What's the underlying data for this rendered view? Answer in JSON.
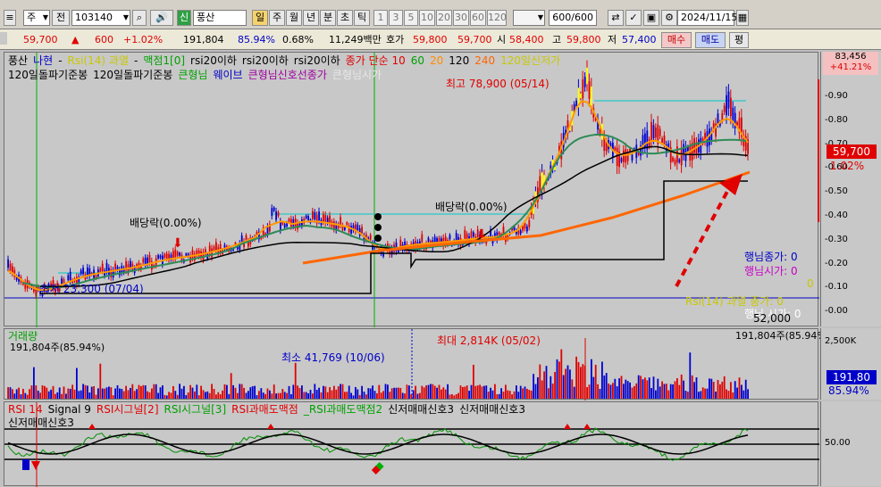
{
  "toolbar": {
    "market": "주",
    "period_label": "전",
    "code": "103140",
    "badge": "신",
    "stock_name": "풍산",
    "periods": [
      "일",
      "주",
      "월",
      "년",
      "분",
      "초",
      "틱"
    ],
    "active_period": "일",
    "minutes": [
      "1",
      "3",
      "5",
      "10",
      "20",
      "30",
      "60",
      "120"
    ],
    "count": "600/600",
    "date": "2024/11/15"
  },
  "quote": {
    "price": "59,700",
    "change": "600",
    "change_pct": "+1.02%",
    "volume": "191,804",
    "volume_ratio": "85.94%",
    "turnover_rate": "0.68%",
    "amount": "11,249백만",
    "bid_label": "호가",
    "bid_price": "59,800",
    "ask_price": "59,700",
    "open_label": "시",
    "open": "58,400",
    "high_label": "고",
    "high": "59,800",
    "low_label": "저",
    "low": "57,400",
    "buy_label": "매수",
    "sell_label": "매도",
    "eval_label": "평"
  },
  "price_panel": {
    "legend_line1": [
      {
        "text": "풍산",
        "color": "#000000"
      },
      {
        "text": "나현",
        "color": "#0000c8"
      },
      {
        "text": "-",
        "color": "#000000"
      },
      {
        "text": "Rsi(14) 과열",
        "color": "#c8c800"
      },
      {
        "text": "-",
        "color": "#000000"
      },
      {
        "text": "맥점1[0]",
        "color": "#00a000"
      },
      {
        "text": "rsi20이하",
        "color": "#000000"
      },
      {
        "text": "rsi20이하",
        "color": "#000000"
      },
      {
        "text": "rsi20이하",
        "color": "#000000"
      },
      {
        "text": "종가 단순 10",
        "color": "#e00000"
      },
      {
        "text": "60",
        "color": "#00a000"
      },
      {
        "text": "20",
        "color": "#ff8c00"
      },
      {
        "text": "120",
        "color": "#000000"
      },
      {
        "text": "240",
        "color": "#ff6600"
      },
      {
        "text": "120일신저가",
        "color": "#c8c800"
      }
    ],
    "legend_line2": [
      {
        "text": "120일돌파기준봉",
        "color": "#000000"
      },
      {
        "text": "120일돌파기준봉",
        "color": "#000000"
      },
      {
        "text": "큰형님",
        "color": "#00a000"
      },
      {
        "text": "웨이브",
        "color": "#0000c8"
      },
      {
        "text": "큰형님신호선종가",
        "color": "#a000a0"
      },
      {
        "text": "큰형님시가",
        "color": "#e8e8e8"
      }
    ],
    "max_label": "최고 78,900 (05/14)",
    "min_label": "최저 23,300 (07/04)",
    "dividend_label_1": "배당락(0.00%)",
    "dividend_label_2": "배당락(0.00%)",
    "right_labels": [
      {
        "text": "행님종가: 0",
        "color": "#0000c8"
      },
      {
        "text": "행님시가: 0",
        "color": "#c800c8"
      },
      {
        "text": "0",
        "color": "#c8c800"
      },
      {
        "text": "Rsi(14) 과열 종가: 0",
        "color": "#c8c800"
      },
      {
        "text": "행님 시가: 0",
        "color": "#ffffff"
      },
      {
        "text": "52,000",
        "color": "#000000"
      }
    ],
    "axis_top_value": "83,456",
    "axis_top_pct": "+41.21%",
    "axis_ticks": [
      "0.90",
      "0.80",
      "0.70",
      "0.60",
      "0.50",
      "0.40",
      "0.30",
      "0.20",
      "0.10",
      "0.00"
    ],
    "current_price": "59,700",
    "current_pct": "1.02%"
  },
  "volume_panel": {
    "title": "거래량",
    "subtitle": "191,804주(85.94%)",
    "right_info": "191,804주(85.94%)",
    "max_label": "최대 2,814K (05/02)",
    "min_label": "최소 41,769 (10/06)",
    "axis_tick": "2,500K",
    "current_vol": "191,80",
    "current_pct": "85.94%"
  },
  "rsi_panel": {
    "legend_line1": [
      {
        "text": "RSI 14",
        "color": "#e00000"
      },
      {
        "text": "Signal 9",
        "color": "#000000"
      },
      {
        "text": "RSI시그널[2]",
        "color": "#e00000"
      },
      {
        "text": "RSI시그널[3]",
        "color": "#00a000"
      },
      {
        "text": "RSI과매도맥점",
        "color": "#e00000"
      },
      {
        "text": "_RSI과매도맥점2",
        "color": "#00a000"
      },
      {
        "text": "신저매매신호3",
        "color": "#000000"
      },
      {
        "text": "신저매매신호3",
        "color": "#000000"
      }
    ],
    "legend_line2": "신저매매신호3",
    "axis_tick": "50.00"
  },
  "colors": {
    "up": "#e00000",
    "down": "#0000d0",
    "ma5": "#e00000",
    "ma20": "#ff9900",
    "ma60": "#2e8b57",
    "ma120": "#000000",
    "ma240": "#ff6600",
    "bar_yellow": "#ffff00"
  }
}
